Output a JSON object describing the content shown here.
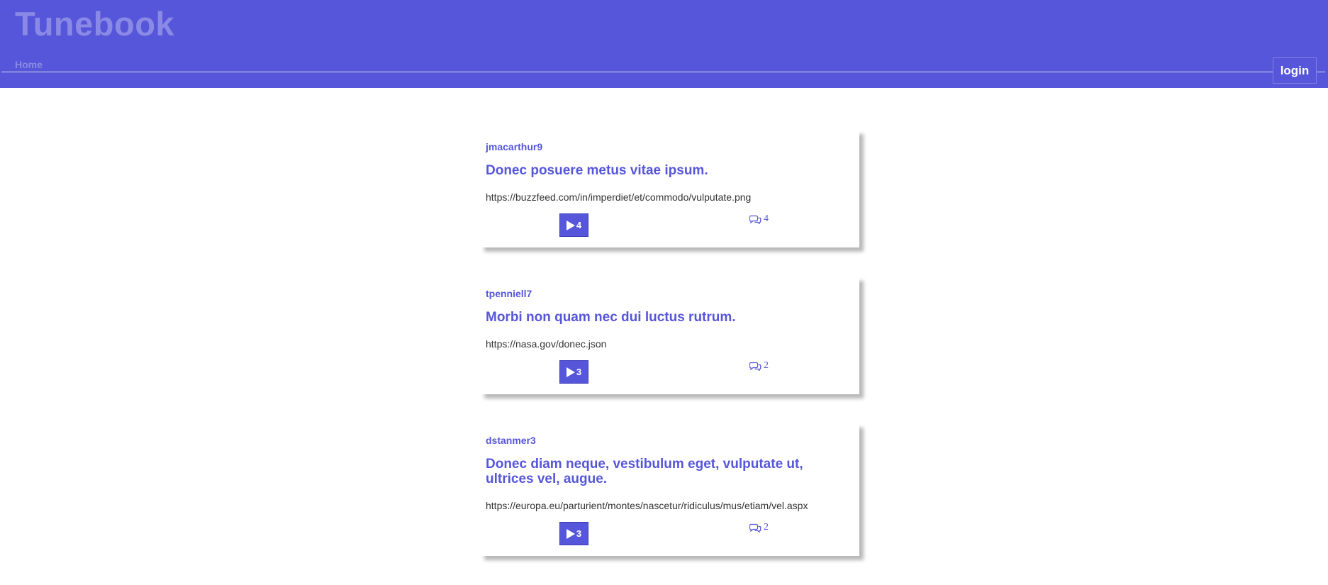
{
  "header": {
    "brand": "Tunebook",
    "nav": {
      "home_label": "Home"
    },
    "login_label": "login"
  },
  "colors": {
    "accent": "#5656da",
    "brand_text": "#8a8ae6",
    "body_text": "#333333"
  },
  "posts": [
    {
      "user": "jmacarthur9",
      "title": "Donec posuere metus vitae ipsum.",
      "url": "https://buzzfeed.com/in/imperdiet/et/commodo/vulputate.png",
      "plays": "4",
      "comments": "4"
    },
    {
      "user": "tpenniell7",
      "title": "Morbi non quam nec dui luctus rutrum.",
      "url": "https://nasa.gov/donec.json",
      "plays": "3",
      "comments": "2"
    },
    {
      "user": "dstanmer3",
      "title": "Donec diam neque, vestibulum eget, vulputate ut, ultrices vel, augue.",
      "url": "https://europa.eu/parturient/montes/nascetur/ridiculus/mus/etiam/vel.aspx",
      "plays": "3",
      "comments": "2"
    }
  ],
  "icons": {
    "play": "play-icon",
    "comment": "comment-icon"
  }
}
